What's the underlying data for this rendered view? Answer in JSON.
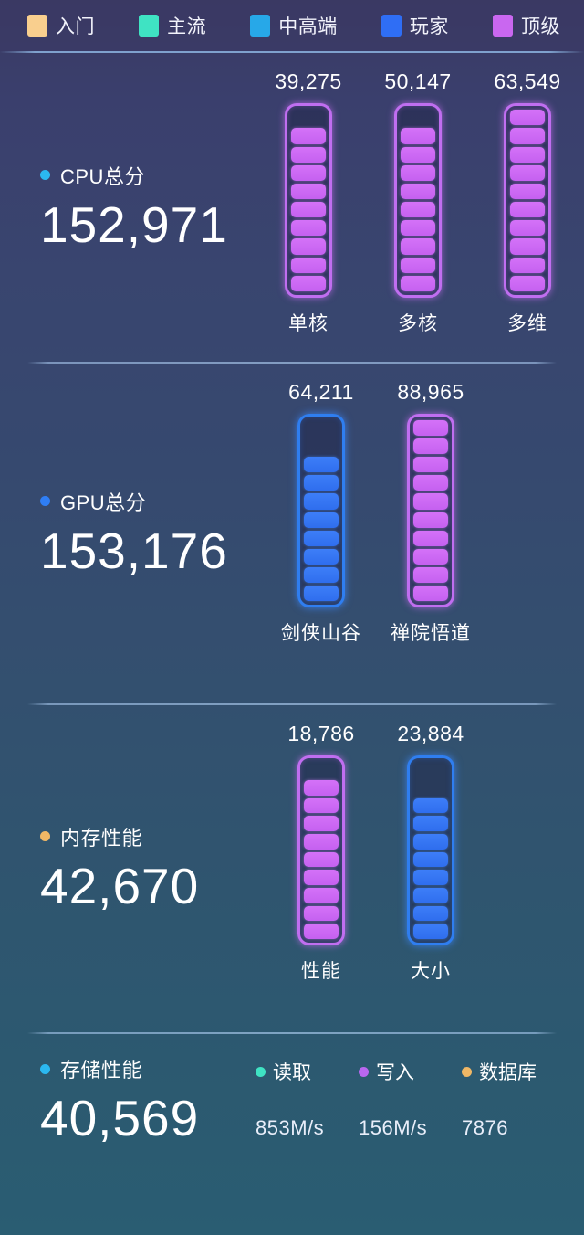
{
  "legend": {
    "items": [
      {
        "label": "入门",
        "color": "#f9cf8e"
      },
      {
        "label": "主流",
        "color": "#3fe3c3"
      },
      {
        "label": "中高端",
        "color": "#27a8e8"
      },
      {
        "label": "玩家",
        "color": "#2f6ef5"
      },
      {
        "label": "顶级",
        "color": "#c967f0"
      }
    ]
  },
  "sections": [
    {
      "id": "cpu",
      "title": "CPU总分",
      "total": "152,971",
      "dot_color": "#2bb8f0",
      "bars": [
        {
          "label": "单核",
          "value": "39,275",
          "color": "purple",
          "filled": 9,
          "total": 10
        },
        {
          "label": "多核",
          "value": "50,147",
          "color": "purple",
          "filled": 9,
          "total": 10
        },
        {
          "label": "多维",
          "value": "63,549",
          "color": "purple",
          "filled": 10,
          "total": 10
        }
      ]
    },
    {
      "id": "gpu",
      "title": "GPU总分",
      "total": "153,176",
      "dot_color": "#2f7ef5",
      "bars": [
        {
          "label": "剑侠山谷",
          "value": "64,211",
          "color": "blue",
          "filled": 8,
          "total": 10
        },
        {
          "label": "禅院悟道",
          "value": "88,965",
          "color": "purple",
          "filled": 10,
          "total": 10
        }
      ]
    },
    {
      "id": "memory",
      "title": "内存性能",
      "total": "42,670",
      "dot_color": "#f0b765",
      "bars": [
        {
          "label": "性能",
          "value": "18,786",
          "color": "purple",
          "filled": 9,
          "total": 10
        },
        {
          "label": "大小",
          "value": "23,884",
          "color": "blue",
          "filled": 8,
          "total": 10
        }
      ]
    }
  ],
  "storage": {
    "title": "存储性能",
    "total": "40,569",
    "dot_color": "#2bb8f0",
    "metrics": [
      {
        "label": "读取",
        "value": "853M/s",
        "dot_color": "#3fe3c3"
      },
      {
        "label": "写入",
        "value": "156M/s",
        "dot_color": "#b967f0"
      },
      {
        "label": "数据库",
        "value": "7876",
        "dot_color": "#f0b765"
      }
    ]
  },
  "chart_data": {
    "type": "bar",
    "title": "设备跑分结果",
    "orientation": "vertical-segmented-gauge",
    "legend": {
      "position": "top",
      "entries": [
        "入门",
        "主流",
        "中高端",
        "玩家",
        "顶级"
      ],
      "colors": [
        "#f9cf8e",
        "#3fe3c3",
        "#27a8e8",
        "#2f6ef5",
        "#c967f0"
      ]
    },
    "groups": [
      {
        "name": "CPU总分",
        "total": 152971,
        "categories": [
          "单核",
          "多核",
          "多维"
        ],
        "values": [
          39275,
          50147,
          63549
        ],
        "segments_filled": [
          9,
          9,
          10
        ],
        "segments_total": 10,
        "tiers": [
          "顶级",
          "顶级",
          "顶级"
        ]
      },
      {
        "name": "GPU总分",
        "total": 153176,
        "categories": [
          "剑侠山谷",
          "禅院悟道"
        ],
        "values": [
          64211,
          88965
        ],
        "segments_filled": [
          8,
          10
        ],
        "segments_total": 10,
        "tiers": [
          "玩家",
          "顶级"
        ]
      },
      {
        "name": "内存性能",
        "total": 42670,
        "categories": [
          "性能",
          "大小"
        ],
        "values": [
          18786,
          23884
        ],
        "segments_filled": [
          9,
          8
        ],
        "segments_total": 10,
        "tiers": [
          "顶级",
          "玩家"
        ]
      },
      {
        "name": "存储性能",
        "total": 40569,
        "categories": [
          "读取",
          "写入",
          "数据库"
        ],
        "values": [
          "853M/s",
          "156M/s",
          "7876"
        ],
        "tiers": [
          "主流",
          "顶级",
          "入门"
        ]
      }
    ]
  }
}
